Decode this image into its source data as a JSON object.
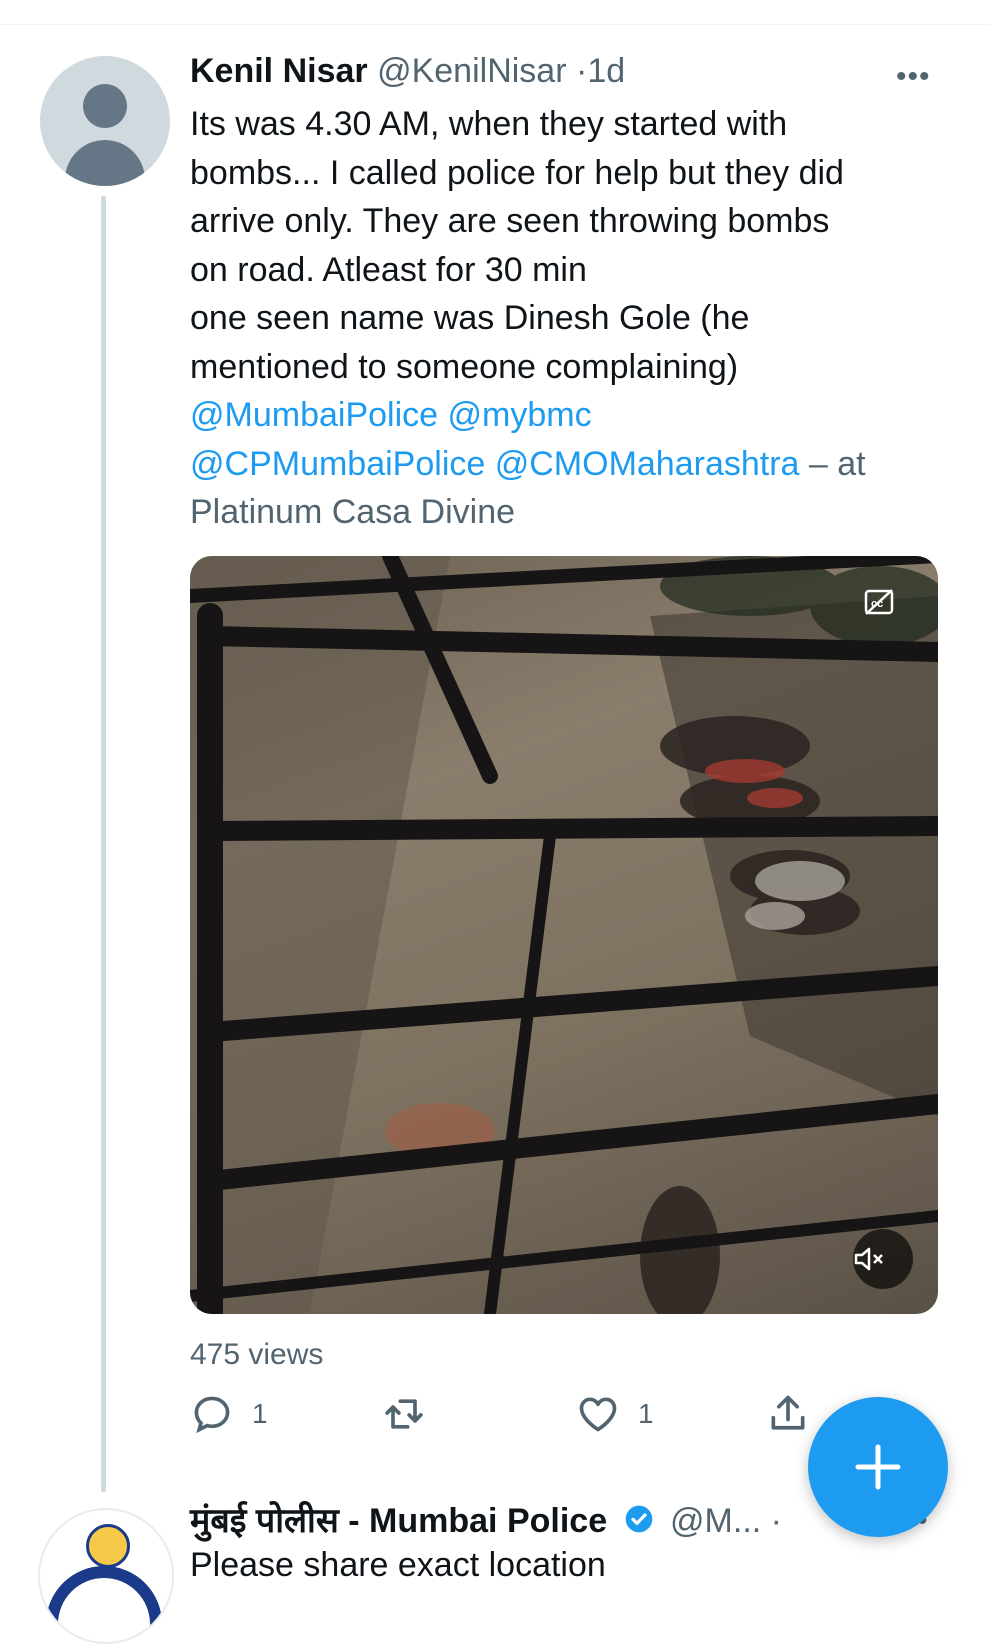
{
  "tweet": {
    "author_name": "Kenil Nisar",
    "handle": "@KenilNisar",
    "separator": "·",
    "time": "1d",
    "more_label": "•••",
    "lines": [
      "Its was 4.30 AM, when they started with",
      "bombs... I called police for help but they did",
      "arrive only. They are seen throwing bombs",
      "on road. Atleast for 30 min",
      "one seen name was Dinesh Gole (he",
      "mentioned to someone complaining)"
    ],
    "mention_1": "@MumbaiPolice",
    "mention_2": "@mybmc",
    "mention_3": "@CPMumbaiPolice",
    "mention_4": "@CMOMaharashtra",
    "location_prefix": " – at",
    "location": "Platinum Casa Divine",
    "views": "475 views",
    "reply_count": "1",
    "retweet_count": "",
    "like_count": "1",
    "cc_icon": "closed-captions-icon",
    "mute_icon": "mute-icon"
  },
  "reply": {
    "author_name": "मुंबई पोलीस - Mumbai Police",
    "handle": "@M...",
    "separator": "·",
    "more_label": "•••",
    "text_partial": "Please share exact location"
  },
  "colors": {
    "accent": "#1d9bf0",
    "text": "#0f1419",
    "secondary": "#536471",
    "thread_line": "#cfd9de"
  }
}
